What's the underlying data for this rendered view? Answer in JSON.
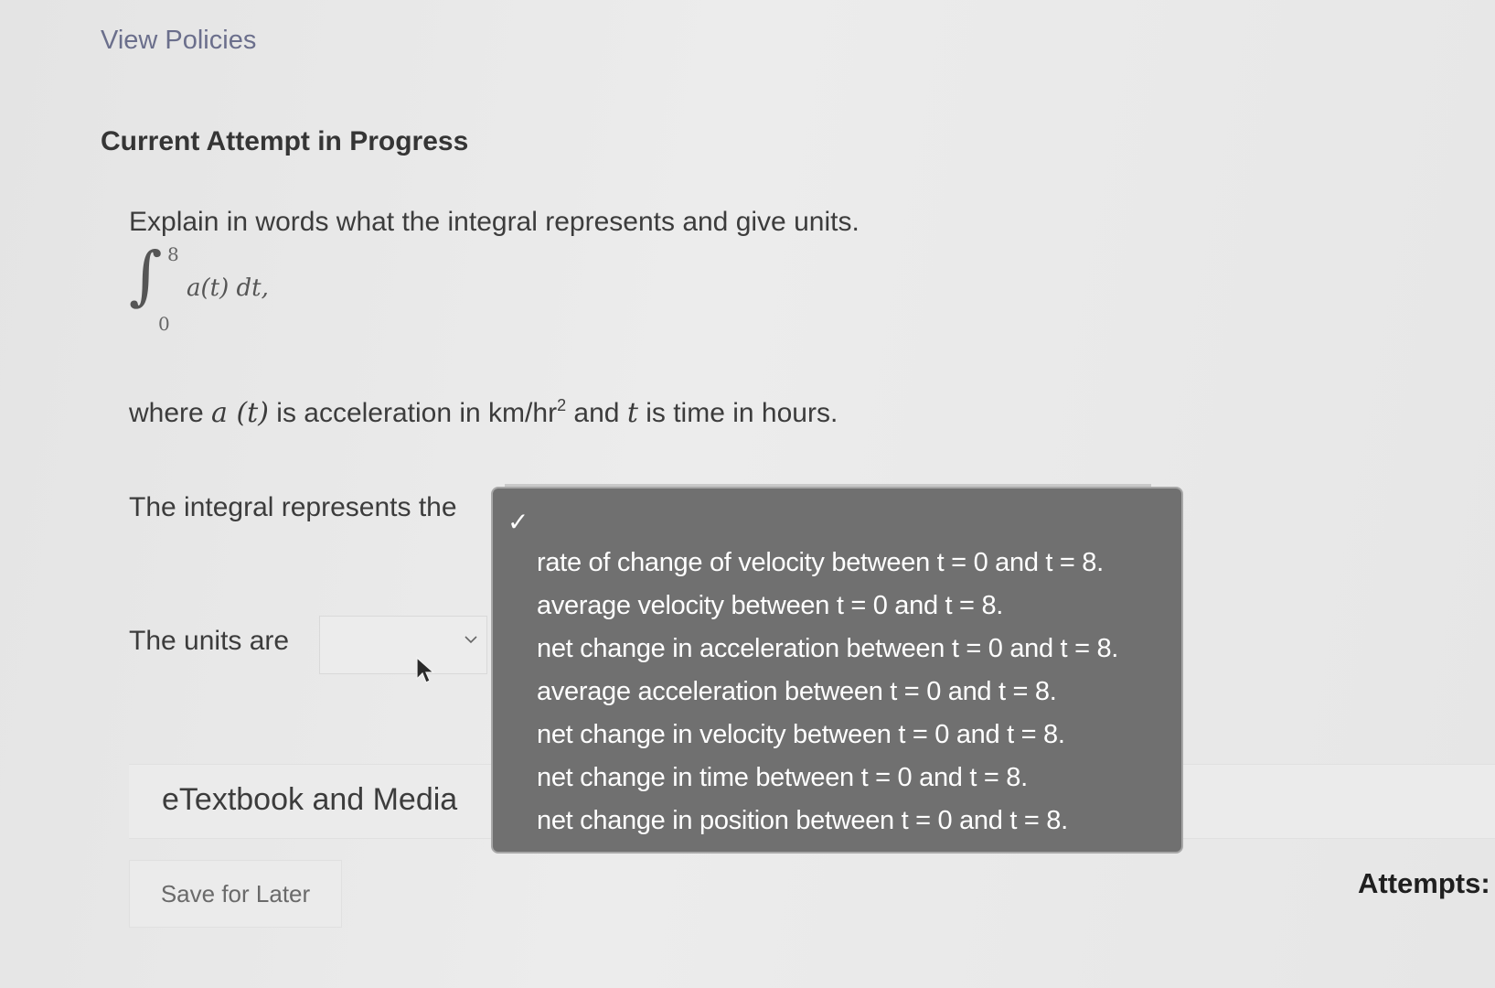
{
  "header": {
    "link": "View Policies",
    "heading": "Current Attempt in Progress"
  },
  "question": {
    "prompt": "Explain in words what the integral represents and give units.",
    "integral": {
      "upper": "8",
      "lower": "0",
      "expression": "a(t) dt,"
    },
    "where": {
      "part1": "where ",
      "var_a": "a (t)",
      "part2": " is acceleration in km/hr",
      "exponent": "2",
      "part3": " and ",
      "var_t": "t",
      "part4": " is time in hours."
    },
    "represents_label": "The integral represents the",
    "units_label": "The units are"
  },
  "dropdown": {
    "selected_marker": "✓",
    "options": [
      "rate of change of velocity between t = 0 and t = 8.",
      "average velocity between t = 0 and t = 8.",
      "net change in acceleration between t = 0 and t = 8.",
      "average acceleration between t = 0 and t = 8.",
      "net change in velocity between t = 0 and t = 8.",
      "net change in time between t = 0 and t = 8.",
      "net change in position between t = 0 and t = 8."
    ]
  },
  "etextbook": {
    "label": "eTextbook and Media"
  },
  "footer": {
    "save_label": "Save for Later",
    "attempts_label": "Attempts:"
  }
}
